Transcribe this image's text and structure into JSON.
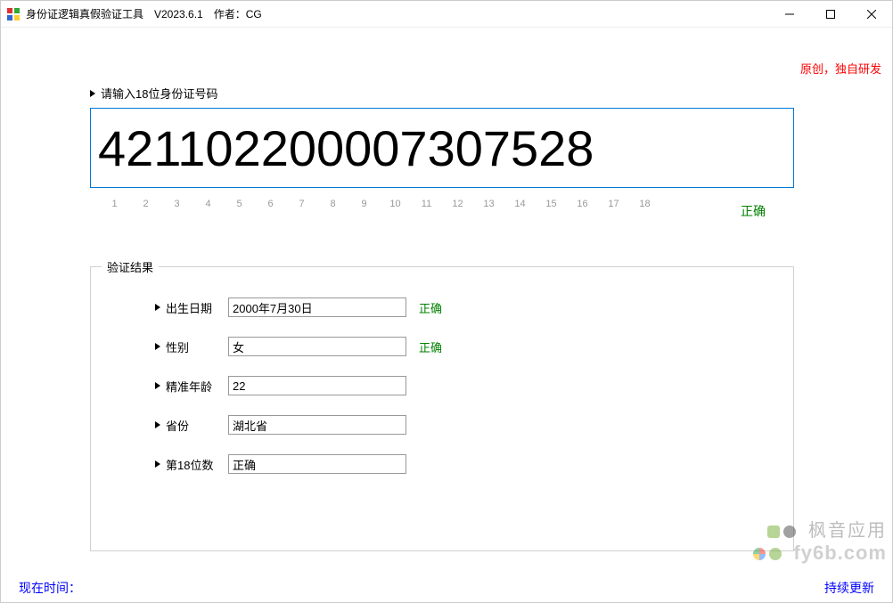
{
  "window": {
    "title": "身份证逻辑真假验证工具　V2023.6.1　作者：CG"
  },
  "credits": "原创，独自研发",
  "input": {
    "label": "请输入18位身份证号码",
    "value": "42110220000730752"
  },
  "trailing_digit": "8",
  "positions": [
    "1",
    "2",
    "3",
    "4",
    "5",
    "6",
    "7",
    "8",
    "9",
    "10",
    "11",
    "12",
    "13",
    "14",
    "15",
    "16",
    "17",
    "18"
  ],
  "overall_status": "正确",
  "results": {
    "legend": "验证结果",
    "fields": [
      {
        "label": "出生日期",
        "value": "2000年7月30日",
        "status": "正确"
      },
      {
        "label": "性别",
        "value": "女",
        "status": "正确"
      },
      {
        "label": "精准年龄",
        "value": "22",
        "status": ""
      },
      {
        "label": "省份",
        "value": "湖北省",
        "status": ""
      },
      {
        "label": "第18位数",
        "value": "正确",
        "status": ""
      }
    ]
  },
  "footer": {
    "left": "现在时间：",
    "right": "持续更新"
  },
  "watermark": {
    "line1": "枫音应用",
    "line2": "fy6b.com"
  }
}
